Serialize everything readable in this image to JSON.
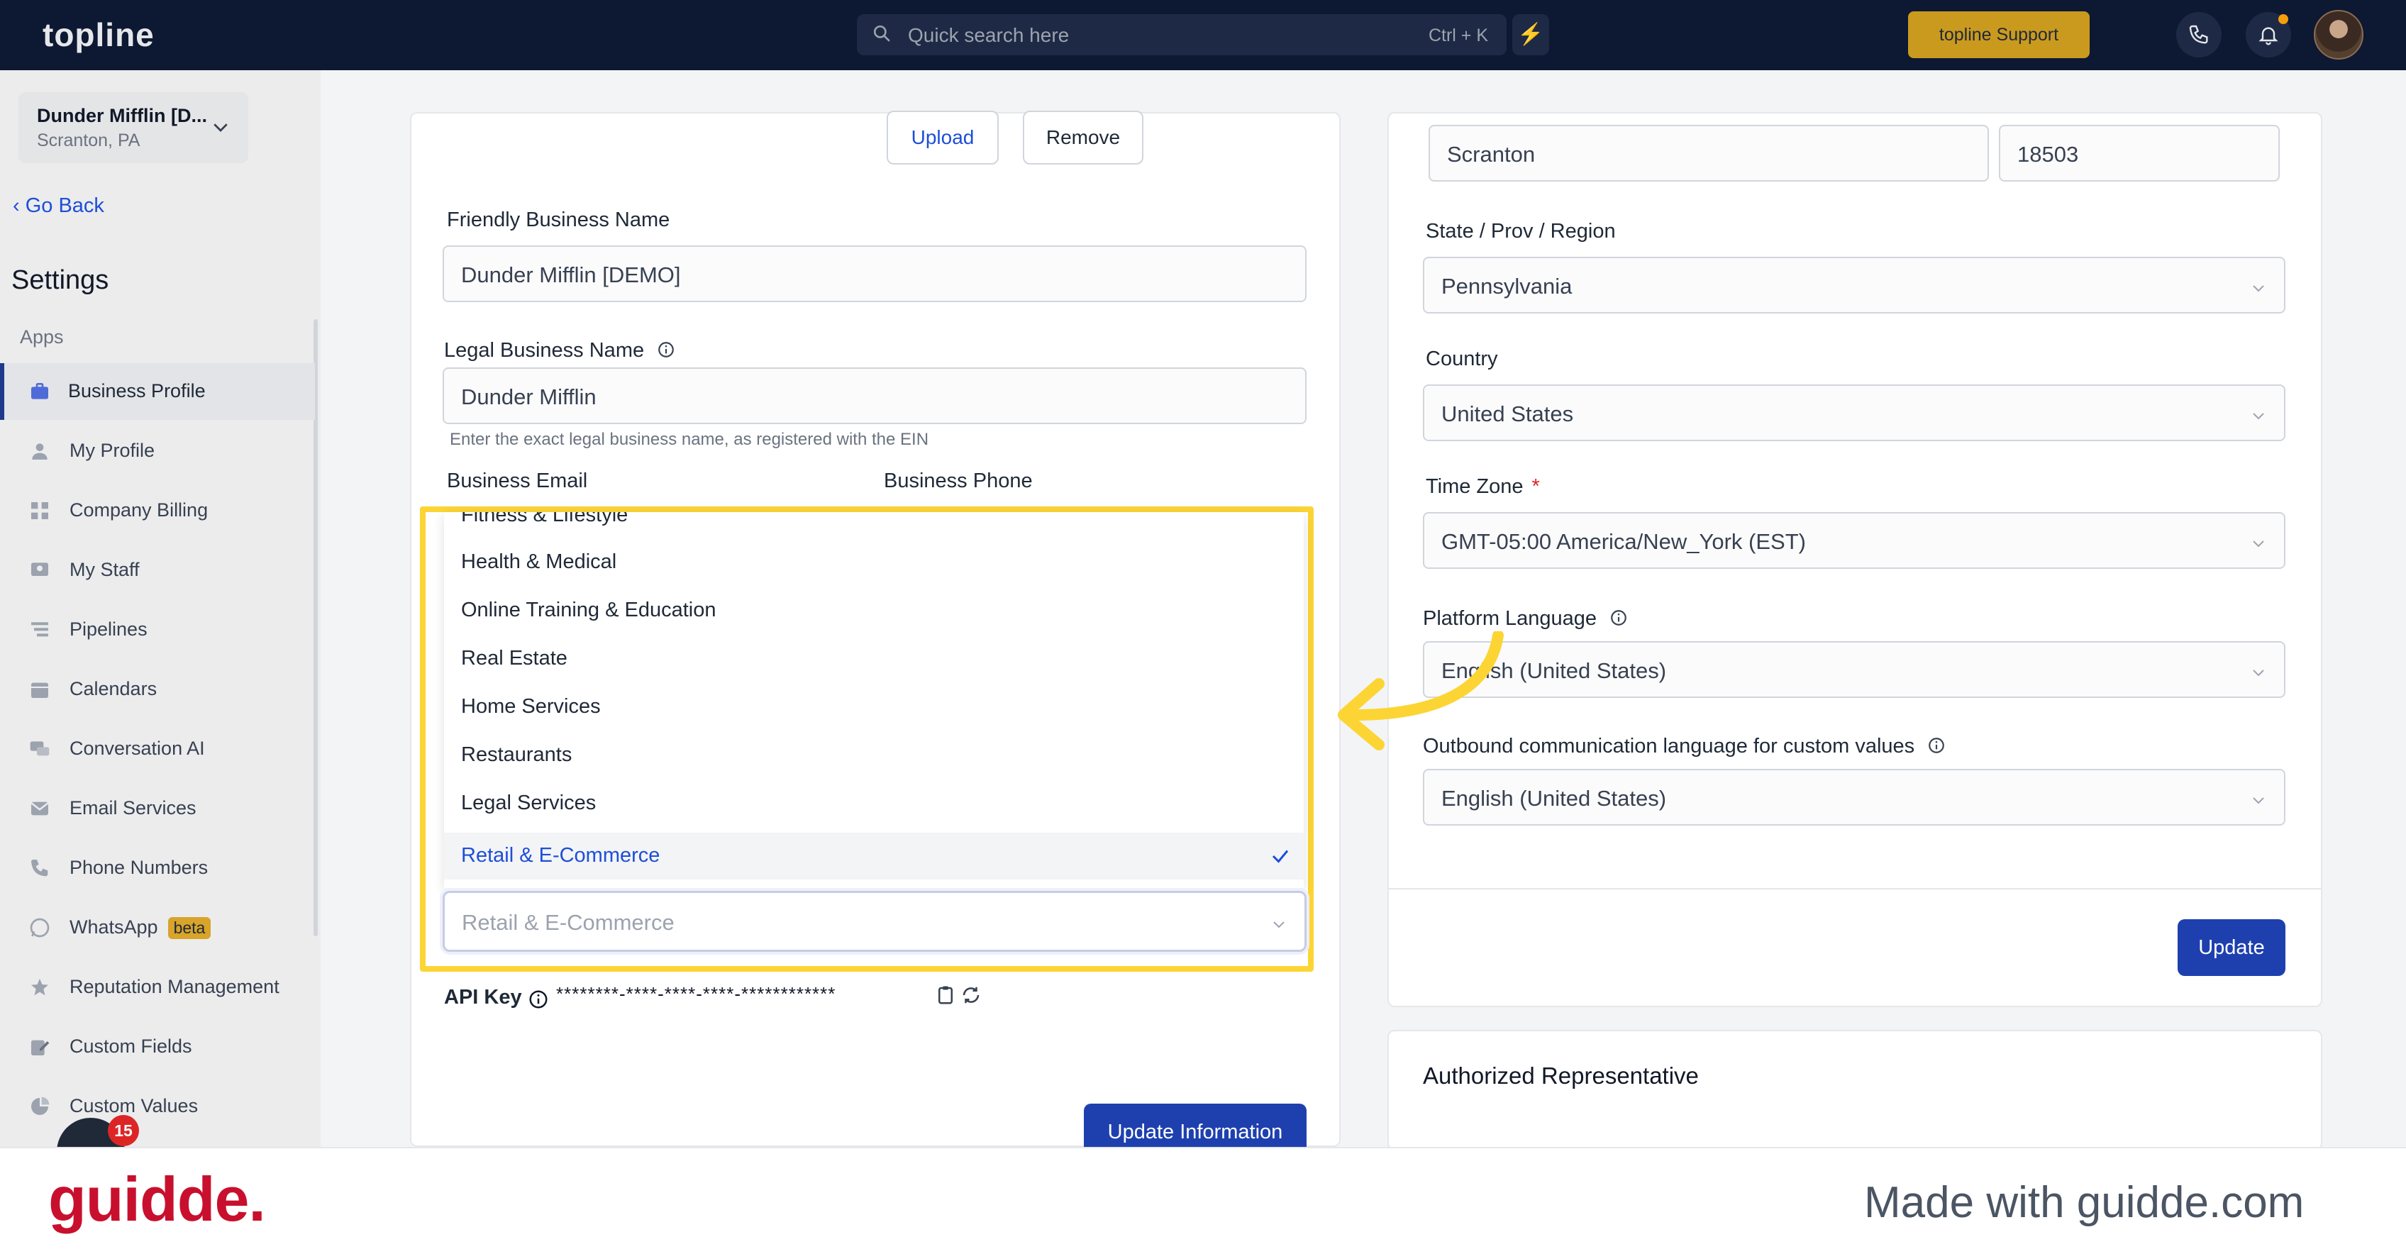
{
  "topbar": {
    "logo": "topline",
    "search_placeholder": "Quick search here",
    "search_shortcut": "Ctrl + K",
    "support_label": "topline Support"
  },
  "sidebar": {
    "location_name": "Dunder Mifflin [D...",
    "location_city": "Scranton, PA",
    "go_back": "Go Back",
    "title": "Settings",
    "section": "Apps",
    "items": [
      {
        "label": "Business Profile",
        "icon": "briefcase-icon",
        "active": true
      },
      {
        "label": "My Profile",
        "icon": "user-icon"
      },
      {
        "label": "Company Billing",
        "icon": "grid-icon"
      },
      {
        "label": "My Staff",
        "icon": "staff-icon"
      },
      {
        "label": "Pipelines",
        "icon": "pipeline-icon"
      },
      {
        "label": "Calendars",
        "icon": "calendar-icon"
      },
      {
        "label": "Conversation AI",
        "icon": "chat-icon"
      },
      {
        "label": "Email Services",
        "icon": "email-icon"
      },
      {
        "label": "Phone Numbers",
        "icon": "phone-icon"
      },
      {
        "label": "WhatsApp",
        "icon": "whatsapp-icon",
        "badge": "beta"
      },
      {
        "label": "Reputation Management",
        "icon": "star-icon"
      },
      {
        "label": "Custom Fields",
        "icon": "edit-icon"
      },
      {
        "label": "Custom Values",
        "icon": "pie-icon"
      }
    ],
    "chat_badge": "15"
  },
  "left_panel": {
    "upload_label": "Upload",
    "remove_label": "Remove",
    "friendly_name_label": "Friendly Business Name",
    "friendly_name_value": "Dunder Mifflin [DEMO]",
    "legal_name_label": "Legal Business Name",
    "legal_name_value": "Dunder Mifflin",
    "legal_name_hint": "Enter the exact legal business name, as registered with the EIN",
    "email_label": "Business Email",
    "phone_label": "Business Phone",
    "api_key_label": "API Key",
    "api_key_value": "********-****-****-****-************",
    "update_label": "Update Information"
  },
  "dropdown": {
    "options": [
      "Fitness & Lifestyle",
      "Health & Medical",
      "Online Training & Education",
      "Real Estate",
      "Home Services",
      "Restaurants",
      "Legal Services",
      "Retail & E-Commerce"
    ],
    "selected": "Retail & E-Commerce",
    "select_value": "Retail & E-Commerce"
  },
  "right_panel": {
    "city_value": "Scranton",
    "zip_value": "18503",
    "state_label": "State / Prov / Region",
    "state_value": "Pennsylvania",
    "country_label": "Country",
    "country_value": "United States",
    "timezone_label": "Time Zone",
    "timezone_required": "*",
    "timezone_value": "GMT-05:00 America/New_York (EST)",
    "platform_lang_label": "Platform Language",
    "platform_lang_value": "English (United States)",
    "outbound_lang_label": "Outbound communication language for custom values",
    "outbound_lang_value": "English (United States)",
    "update_label": "Update",
    "auth_title": "Authorized Representative"
  },
  "footer": {
    "brand": "guidde.",
    "made_with": "Made with guidde.com"
  },
  "colors": {
    "topbar": "#0d1832",
    "accent": "#1e40af",
    "highlight": "#fcd535",
    "support": "#ca9a1e",
    "brand_red": "#c8102e"
  }
}
